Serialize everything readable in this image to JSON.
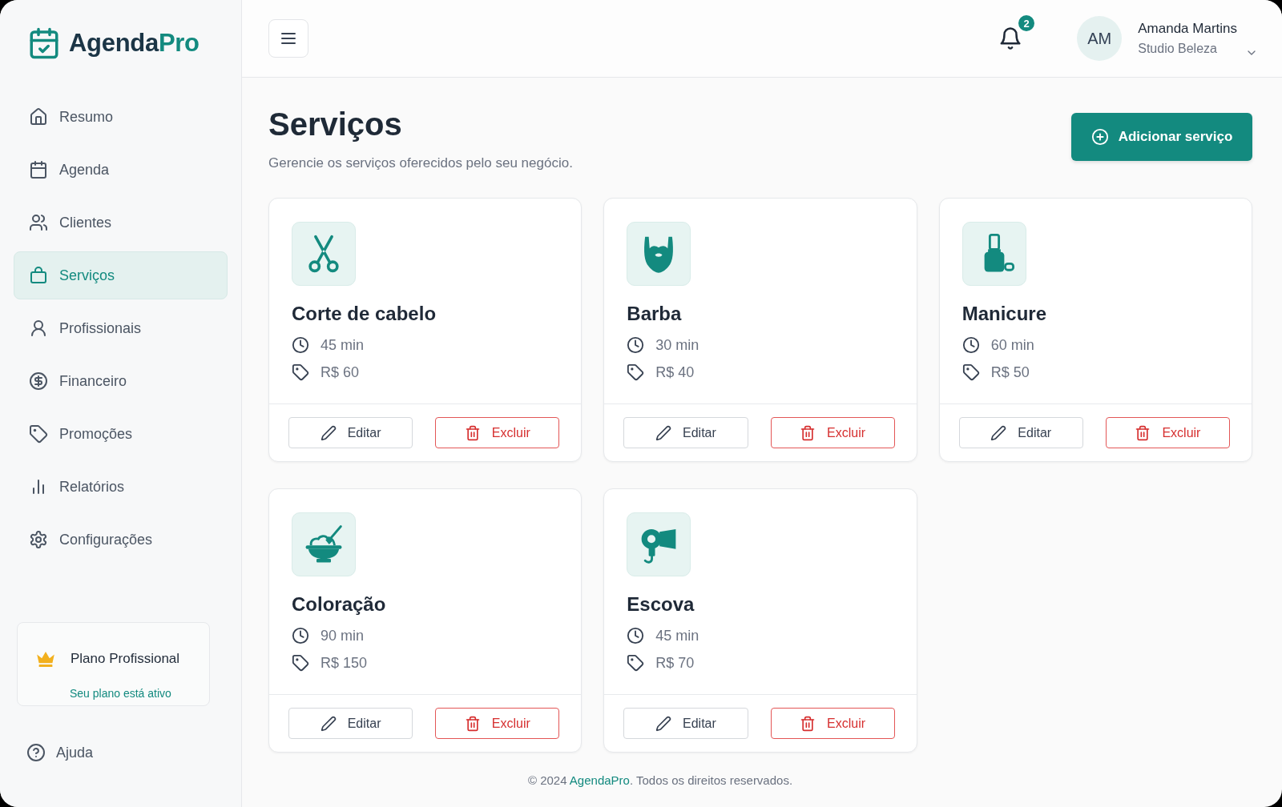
{
  "sidebar": {
    "logo": {
      "text": "Agenda",
      "accent": "Pro"
    },
    "nav_items": [
      {
        "label": "Resumo",
        "selected": false
      },
      {
        "label": "Agenda",
        "selected": false
      },
      {
        "label": "Clientes",
        "selected": false
      },
      {
        "label": "Serviços",
        "selected": true
      },
      {
        "label": "Profissionais",
        "selected": false
      },
      {
        "label": "Financeiro",
        "selected": false
      },
      {
        "label": "Promoções",
        "selected": false
      },
      {
        "label": "Relatórios",
        "selected": false
      },
      {
        "label": "Configurações",
        "selected": false
      }
    ],
    "plan_card": {
      "title": "Plano Profissional",
      "status": "Seu plano está ativo"
    },
    "help": {
      "label": "Ajuda"
    }
  },
  "header": {
    "notification_count": "2",
    "user": {
      "initials": "AM",
      "name": "Amanda Martins",
      "business": "Studio Beleza"
    }
  },
  "page": {
    "title": "Serviços",
    "subtitle": "Gerencie os serviços oferecidos pelo seu negócio.",
    "add_button": "Adicionar serviço"
  },
  "services": [
    {
      "name": "Corte de cabelo",
      "duration": "45 min",
      "price": "R$ 60",
      "edit_button": "Editar",
      "delete_button": "Excluir"
    },
    {
      "name": "Barba",
      "duration": "30 min",
      "price": "R$ 40",
      "edit_button": "Editar",
      "delete_button": "Excluir"
    },
    {
      "name": "Manicure",
      "duration": "60 min",
      "price": "R$ 50",
      "edit_button": "Editar",
      "delete_button": "Excluir"
    },
    {
      "name": "Coloração",
      "duration": "90 min",
      "price": "R$ 150",
      "edit_button": "Editar",
      "delete_button": "Excluir"
    },
    {
      "name": "Escova",
      "duration": "45 min",
      "price": "R$ 70",
      "edit_button": "Editar",
      "delete_button": "Excluir"
    }
  ],
  "footer": {
    "copyright": "© 2024",
    "link": "AgendaPro",
    "text": ". Todos os direitos reservados."
  }
}
